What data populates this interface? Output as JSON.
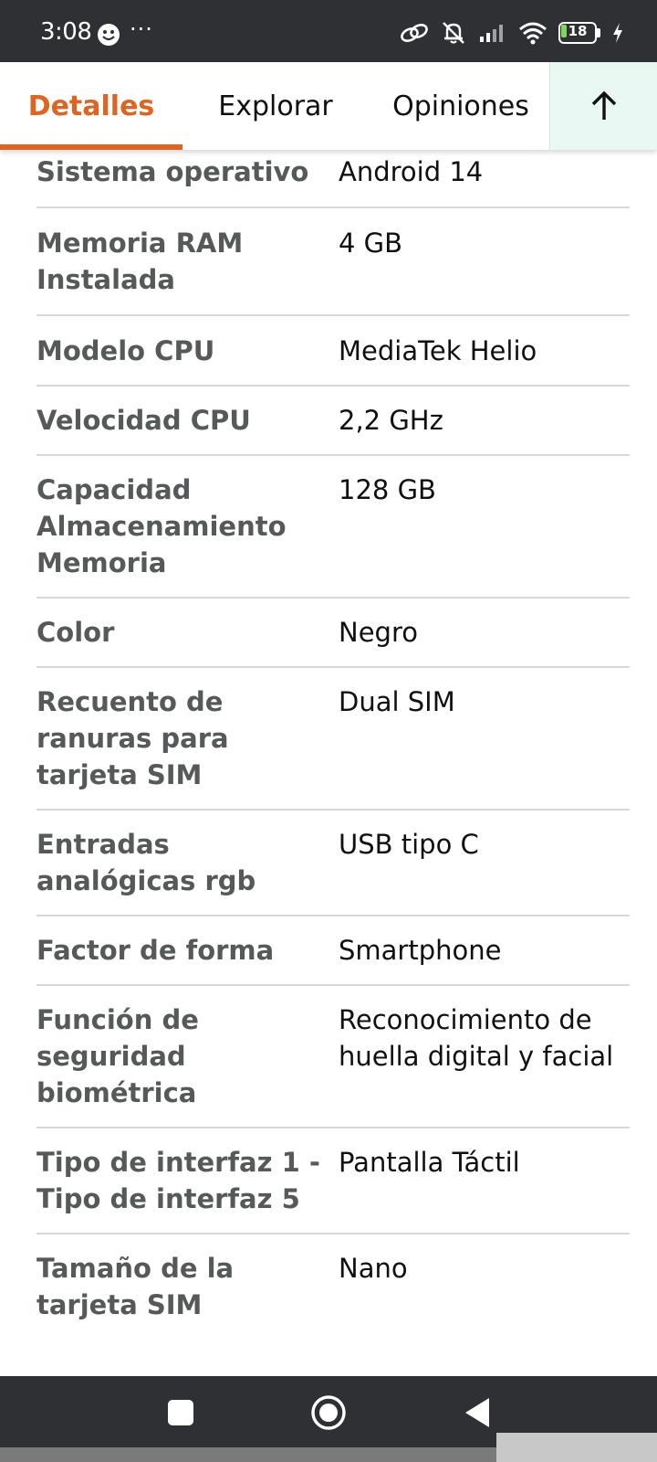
{
  "status_bar": {
    "time": "3:08",
    "dots": "···",
    "battery_level": "18",
    "battery_percent": 18,
    "battery_color": "#7ed957",
    "icons": [
      "smiley-face-icon",
      "link-icon",
      "bell-muted-icon",
      "signal-icon",
      "wifi-icon",
      "battery-icon",
      "charging-bolt-icon"
    ]
  },
  "tabs": {
    "detalles": "Detalles",
    "explorar": "Explorar",
    "opiniones": "Opiniones",
    "scroll_top_icon": "arrow-up-icon"
  },
  "colors": {
    "accent": "#e0641f",
    "label": "#565959",
    "value": "#0f1111",
    "divider": "#d5d9d9",
    "scroll_top_bg": "#e9f8f2"
  },
  "specs": [
    {
      "label": "Sistema operativo",
      "value": "Android 14"
    },
    {
      "label": "Memoria RAM Instalada",
      "value": "4 GB"
    },
    {
      "label": "Modelo CPU",
      "value": "MediaTek Helio"
    },
    {
      "label": "Velocidad CPU",
      "value": "2,2 GHz"
    },
    {
      "label": "Capacidad Almacenamiento Memoria",
      "value": "128 GB"
    },
    {
      "label": "Color",
      "value": "Negro"
    },
    {
      "label": "Recuento de ranuras para tarjeta SIM",
      "value": "Dual SIM"
    },
    {
      "label": "Entradas analógicas rgb",
      "value": "USB tipo C"
    },
    {
      "label": "Factor de forma",
      "value": "Smartphone"
    },
    {
      "label": "Función de seguridad biométrica",
      "value": "Reconocimiento de huella digital y facial"
    },
    {
      "label": "Tipo de interfaz 1 - Tipo de interfaz 5",
      "value": "Pantalla Táctil"
    },
    {
      "label": "Tamaño de la tarjeta SIM",
      "value": "Nano"
    }
  ],
  "nav_bar": {
    "icons": [
      "recents-square-icon",
      "home-circle-icon",
      "back-triangle-icon"
    ]
  }
}
